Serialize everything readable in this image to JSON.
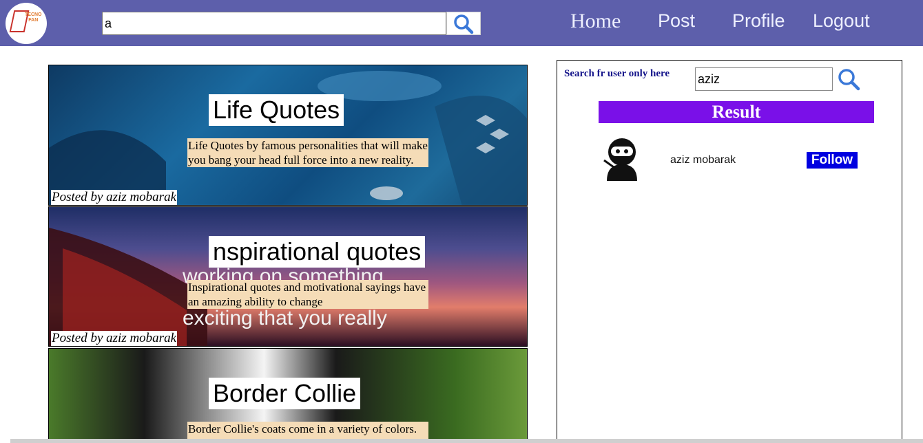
{
  "brand": {
    "logo_text": "TECNO\nFAN"
  },
  "header": {
    "search": {
      "value": "a"
    },
    "nav": [
      {
        "label": "Home"
      },
      {
        "label": "Post"
      },
      {
        "label": "Profile"
      },
      {
        "label": "Logout"
      }
    ]
  },
  "posts": [
    {
      "title": "Life Quotes",
      "description": "Life Quotes by famous personalities that will make you bang your head full force into a new reality.",
      "author": "Posted by aziz mobarak"
    },
    {
      "title": "nspirational quotes",
      "description": "Inspirational quotes and motivational sayings have an amazing ability to change",
      "author": "Posted by aziz mobarak",
      "image_text": [
        "working on something",
        "exciting that you really"
      ]
    },
    {
      "title": "Border Collie",
      "description": "Border Collie's coats come in a variety of colors. Black and white is the",
      "author": ""
    }
  ],
  "sidebar": {
    "search_label": "Search fr user only here",
    "search_value": "aziz",
    "result_title": "Result",
    "results": [
      {
        "name": "aziz mobarak",
        "follow_label": "Follow"
      }
    ]
  },
  "colors": {
    "navbar": "#5d5fab",
    "result_header": "#7a10e8",
    "follow_button": "#0000e0",
    "description_bg": "#f5dcb7"
  },
  "icons": [
    "search-icon",
    "user-avatar-icon",
    "logo-icon"
  ]
}
